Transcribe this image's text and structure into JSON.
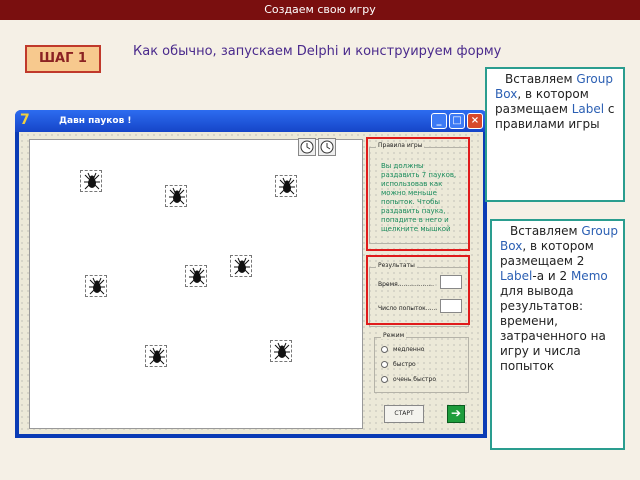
{
  "slide": {
    "title": "Создаем свою игру",
    "step_badge": "ШАГ 1",
    "subtitle": "Как обычно, запускаем Delphi и конструируем форму"
  },
  "window": {
    "title": "Давн пауков !",
    "icon_glyph": "7",
    "buttons": [
      "minimize",
      "maximize",
      "close"
    ]
  },
  "rules_group": {
    "title": "Правила игры",
    "text": "Вы должны раздавить 7 пауков, использовав как можно меньше попыток. Чтобы раздавить паука, попадите в него и щелкните мышкой"
  },
  "results_group": {
    "title": "Результаты",
    "time_label": "Время...................",
    "attempts_label": "Число попыток......"
  },
  "mode_group": {
    "title": "Режим",
    "options": [
      "медленно",
      "быстро",
      "очень быстро"
    ]
  },
  "start_button": "СТАРТ",
  "callout_1": {
    "pre": "Вставляем",
    "group_box": "Group Box",
    "mid": ", в котором размещаем",
    "label": "Label",
    "post": " с правилами игры"
  },
  "callout_2": {
    "pre": "Вставляем",
    "group_box": "Group Box",
    "mid": ", в котором размещаем 2",
    "label": "Label",
    "mid2": "-а и 2",
    "memo": "Memo",
    "post": " для вывода результатов: времени, затраченного на игру и числа попыток"
  },
  "colors": {
    "header": "#7a0f0f",
    "callout_border": "#2a9d8f",
    "highlight_frame": "#e01b1b",
    "rules_text": "#1a8c5c"
  }
}
